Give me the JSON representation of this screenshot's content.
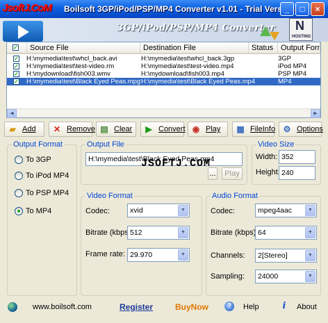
{
  "window": {
    "title": "Boilsoft 3GP/iPod/PSP/MP4 Converter v1.01 - Trial Version",
    "watermark": "JsoftJ.CoM",
    "controls": {
      "minimize": "_",
      "maximize": "□",
      "close": "×"
    }
  },
  "header": {
    "title": "3GP/iPod/PSP/MP4   Converter",
    "badge_letter": "N",
    "badge_text": "HOSTING"
  },
  "file_list": {
    "columns": [
      "Source File",
      "Destination File",
      "Status",
      "Output Format"
    ],
    "rows": [
      {
        "checked": true,
        "source": "H:\\mymedia\\test\\whcl_back.avi",
        "destination": "H:\\mymedia\\test\\whcl_back.3gp",
        "status": "",
        "format": "3GP",
        "selected": false
      },
      {
        "checked": true,
        "source": "H:\\mymedia\\test\\test-video.rm",
        "destination": "H:\\mymedia\\test\\test-video.mp4",
        "status": "",
        "format": "iPod MP4",
        "selected": false
      },
      {
        "checked": true,
        "source": "H:\\mydownload\\fish003.wmv",
        "destination": "H:\\mydownload\\fish003.mp4",
        "status": "",
        "format": "PSP MP4",
        "selected": false
      },
      {
        "checked": true,
        "source": "H:\\mymedia\\test\\Black Eyed Peas.mpg",
        "destination": "H:\\mymedia\\test\\Black Eyed Peas.mp4",
        "status": "",
        "format": "MP4",
        "selected": true
      }
    ]
  },
  "toolbar": {
    "add": "Add",
    "remove": "Remove",
    "clear": "Clear",
    "convert": "Convert",
    "play": "Play",
    "fileinfo": "FileInfo",
    "options": "Options"
  },
  "output_format": {
    "title": "Output Format",
    "options": [
      "To 3GP",
      "To iPod MP4",
      "To PSP MP4",
      "To MP4"
    ],
    "selected": "To MP4"
  },
  "output_file": {
    "title": "Output File",
    "value": "H:\\mymedia\\test\\Black Eyed Peas.mp4",
    "browse_label": "...",
    "play_label": "Play"
  },
  "watermark_center": "JSOFTJ.COM",
  "video_size": {
    "title": "Video Size",
    "width_label": "Width:",
    "width": "352",
    "height_label": "Height:",
    "height": "240"
  },
  "video_format": {
    "title": "Video Format",
    "codec_label": "Codec:",
    "codec": "xvid",
    "bitrate_label": "Bitrate (kbps):",
    "bitrate": "512",
    "framerate_label": "Frame rate:",
    "framerate": "29.970"
  },
  "audio_format": {
    "title": "Audio Format",
    "codec_label": "Codec:",
    "codec": "mpeg4aac",
    "bitrate_label": "Bitrate (kbps):",
    "bitrate": "64",
    "channels_label": "Channels:",
    "channels": "2[Stereo]",
    "sampling_label": "Sampling:",
    "sampling": "24000"
  },
  "footer": {
    "website": "www.boilsoft.com",
    "register": "Register",
    "buynow": "BuyNow",
    "help": "Help",
    "about": "About"
  }
}
